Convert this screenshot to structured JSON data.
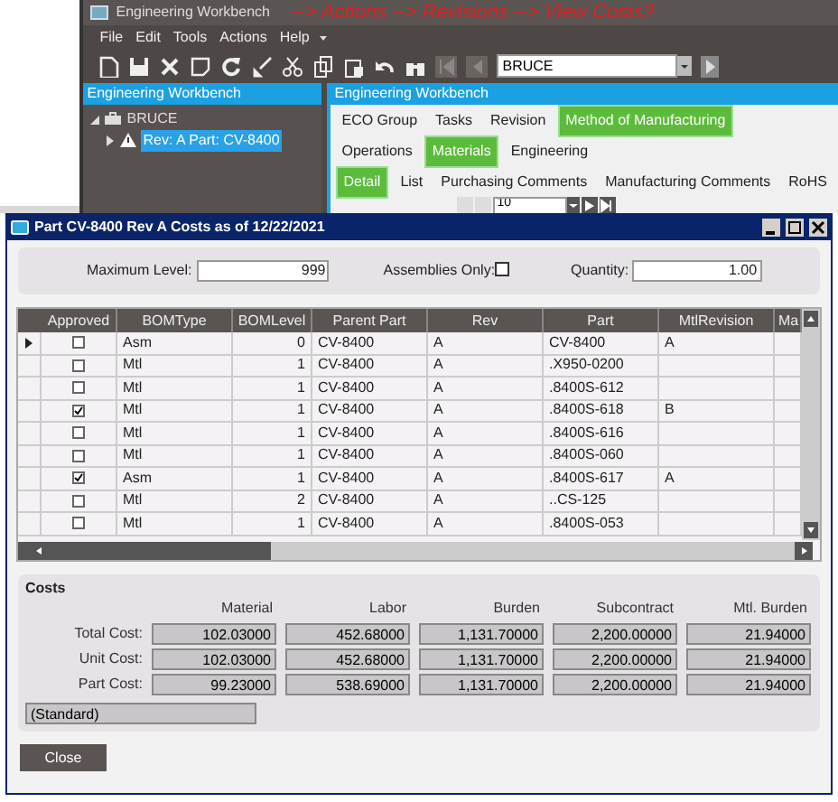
{
  "app": {
    "title": "Engineering Workbench",
    "annotation": "--> Actions --> Revisions --> View Costs?",
    "menu": [
      "File",
      "Edit",
      "Tools",
      "Actions",
      "Help"
    ],
    "search": {
      "value": "BRUCE"
    },
    "tree_panel": {
      "title": "Engineering Workbench",
      "items": [
        {
          "label": "BRUCE",
          "expanded": true,
          "children": [
            {
              "label": "Rev: A Part: CV-8400",
              "selected": true,
              "expanded": false
            }
          ]
        }
      ]
    },
    "main_panel": {
      "title": "Engineering Workbench",
      "tabs": [
        {
          "label": "ECO Group",
          "selected": false
        },
        {
          "label": "Tasks",
          "selected": false
        },
        {
          "label": "Revision",
          "selected": false
        },
        {
          "label": "Method of Manufacturing",
          "selected": true
        }
      ],
      "subtabs": [
        {
          "label": "Operations",
          "selected": false
        },
        {
          "label": "Materials",
          "selected": true
        },
        {
          "label": "Engineering",
          "selected": false
        }
      ],
      "detail_tabs": [
        {
          "label": "Detail",
          "selected": true
        },
        {
          "label": "List",
          "selected": false
        },
        {
          "label": "Purchasing Comments",
          "selected": false
        },
        {
          "label": "Manufacturing Comments",
          "selected": false
        },
        {
          "label": "RoHS",
          "selected": false
        }
      ],
      "navigator": {
        "value": "10"
      }
    }
  },
  "dialog": {
    "title": "Part CV-8400 Rev A Costs as of 12/22/2021",
    "filters": {
      "max_level_label": "Maximum Level:",
      "max_level": "999",
      "assemblies_label": "Assemblies Only:",
      "assemblies_only": false,
      "quantity_label": "Quantity:",
      "quantity": "1.00"
    },
    "table": {
      "check_column": "Approved",
      "columns": [
        "BOMType",
        "BOMLevel",
        "Parent Part",
        "Rev",
        "Part",
        "MtlRevision",
        "Ma"
      ],
      "rows": [
        {
          "selected": true,
          "approved": false,
          "cells": [
            "Asm",
            "0",
            "CV-8400",
            "A",
            "CV-8400",
            "A"
          ]
        },
        {
          "selected": false,
          "approved": false,
          "cells": [
            "Mtl",
            "1",
            "CV-8400",
            "A",
            ".X950-0200",
            ""
          ]
        },
        {
          "selected": false,
          "approved": false,
          "cells": [
            "Mtl",
            "1",
            "CV-8400",
            "A",
            ".8400S-612",
            ""
          ]
        },
        {
          "selected": false,
          "approved": true,
          "cells": [
            "Mtl",
            "1",
            "CV-8400",
            "A",
            ".8400S-618",
            "B"
          ]
        },
        {
          "selected": false,
          "approved": false,
          "cells": [
            "Mtl",
            "1",
            "CV-8400",
            "A",
            ".8400S-616",
            ""
          ]
        },
        {
          "selected": false,
          "approved": false,
          "cells": [
            "Mtl",
            "1",
            "CV-8400",
            "A",
            ".8400S-060",
            ""
          ]
        },
        {
          "selected": false,
          "approved": true,
          "cells": [
            "Asm",
            "1",
            "CV-8400",
            "A",
            ".8400S-617",
            "A"
          ]
        },
        {
          "selected": false,
          "approved": false,
          "cells": [
            "Mtl",
            "2",
            "CV-8400",
            "A",
            "..CS-125",
            ""
          ]
        },
        {
          "selected": false,
          "approved": false,
          "cells": [
            "Mtl",
            "1",
            "CV-8400",
            "A",
            ".8400S-053",
            ""
          ]
        }
      ]
    },
    "costs": {
      "title": "Costs",
      "columns": [
        "Material",
        "Labor",
        "Burden",
        "Subcontract",
        "Mtl. Burden"
      ],
      "rows": [
        {
          "label": "Total Cost:",
          "values": [
            "102.03000",
            "452.68000",
            "1,131.70000",
            "2,200.00000",
            "21.94000"
          ]
        },
        {
          "label": "Unit Cost:",
          "values": [
            "102.03000",
            "452.68000",
            "1,131.70000",
            "2,200.00000",
            "21.94000"
          ]
        },
        {
          "label": "Part Cost:",
          "values": [
            "99.23000",
            "538.69000",
            "1,131.70000",
            "2,200.00000",
            "21.94000"
          ]
        }
      ],
      "method": "(Standard)"
    },
    "close_button": "Close"
  }
}
